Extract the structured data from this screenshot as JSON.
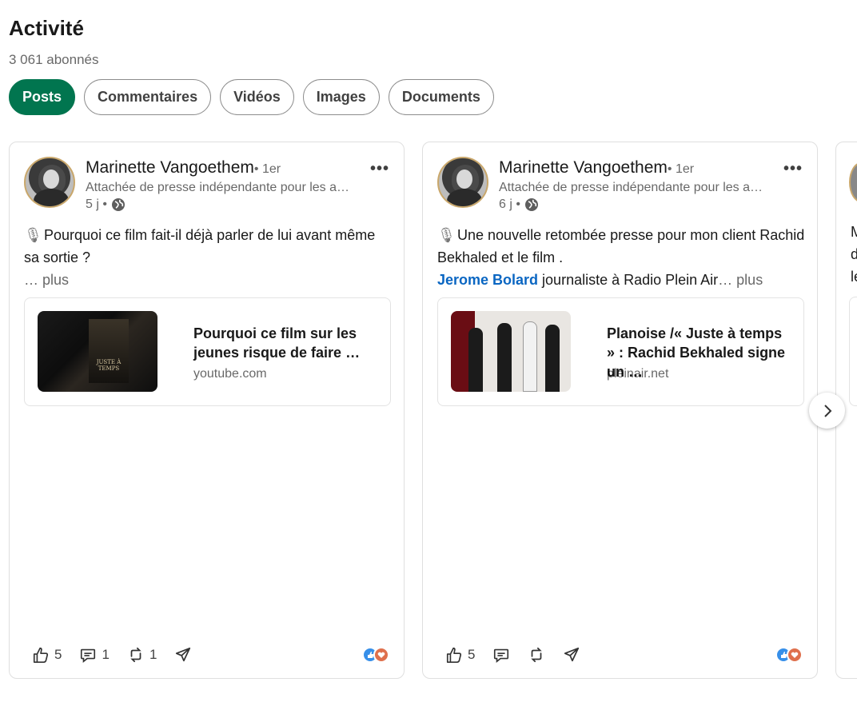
{
  "page": {
    "title": "Activité",
    "followers": "3 061 abonnés"
  },
  "tabs": [
    {
      "label": "Posts"
    },
    {
      "label": "Commentaires"
    },
    {
      "label": "Vidéos"
    },
    {
      "label": "Images"
    },
    {
      "label": "Documents"
    }
  ],
  "posts": [
    {
      "author": "Marinette Vangoethem",
      "degree": "• 1er",
      "headline": "Attachée de presse indépendante pour les a…",
      "time": "5 j •",
      "line1": "Pourquoi ce film fait-il déjà parler de lui avant même sa sortie ?",
      "see_more": "… plus",
      "link_title": "Pourquoi ce film sur les jeunes risque de faire …",
      "link_domain": "youtube.com",
      "thumb_text": "JUSTE À TEMPS",
      "likes": "5",
      "comments": "1",
      "reposts": "1"
    },
    {
      "author": "Marinette Vangoethem",
      "degree": "• 1er",
      "headline": "Attachée de presse indépendante pour les a…",
      "time": "6 j •",
      "line1": "Une nouvelle retombée presse pour mon client Rachid Bekhaled et le film .",
      "mention": "Jerome Bolard",
      "line2": " journaliste à Radio Plein Air",
      "see_more": "… plus",
      "link_title": "Planoise /« Juste à temps » : Rachid Bekhaled signe un …",
      "link_domain": "pleinair.net",
      "likes": "5"
    }
  ],
  "peek": {
    "l1": "M",
    "l2": "d",
    "l3": "le"
  },
  "colors": {
    "active_tab": "#01754f",
    "mention": "#0a66c2",
    "like": "#378fe9",
    "love": "#df704d"
  }
}
